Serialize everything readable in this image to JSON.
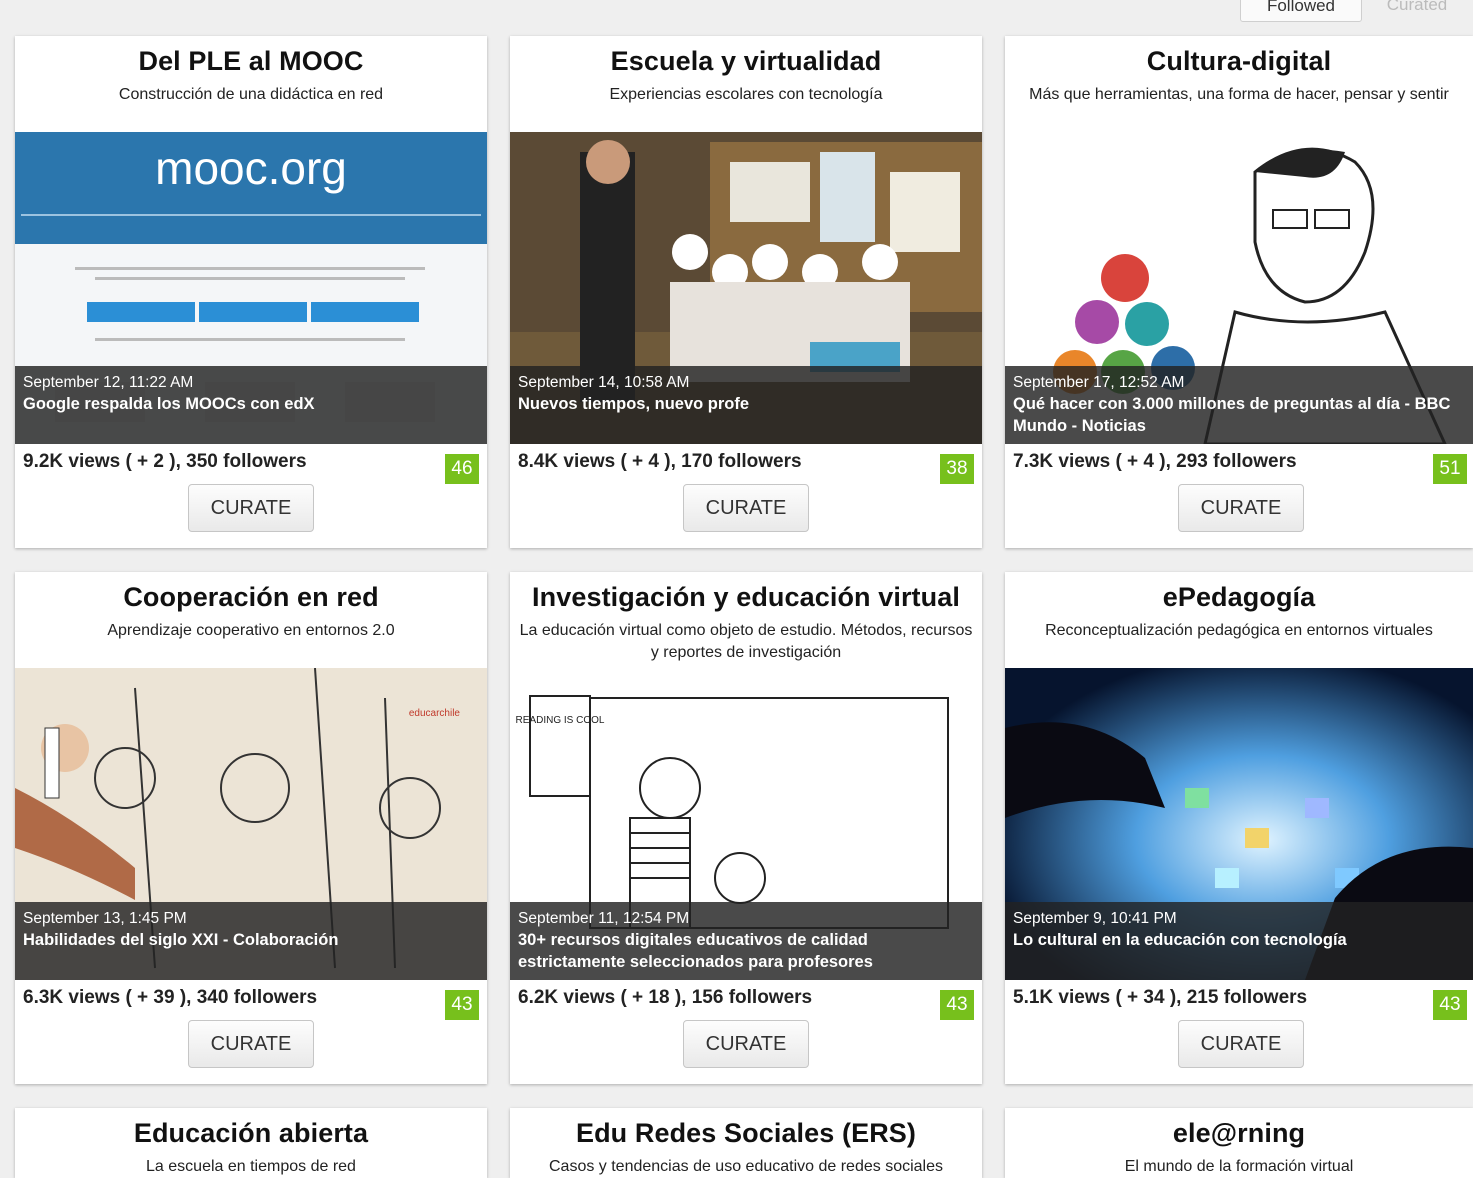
{
  "tabs": {
    "followed": "Followed",
    "curated": "Curated"
  },
  "cards": [
    {
      "title": "Del PLE al MOOC",
      "subtitle": "Construcción de una didáctica en red",
      "date": "September 12, 11:22 AM",
      "post": "Google respalda los MOOCs con edX",
      "stats": "9.2K views ( + 2 ), 350 followers",
      "score": "46",
      "curate": "CURATE",
      "thumb_text": "mooc.org"
    },
    {
      "title": "Escuela y virtualidad",
      "subtitle": "Experiencias escolares con tecnología",
      "date": "September 14, 10:58 AM",
      "post": "Nuevos tiempos, nuevo profe",
      "stats": "8.4K views ( + 4 ), 170 followers",
      "score": "38",
      "curate": "CURATE"
    },
    {
      "title": "Cultura-digital",
      "subtitle": "Más que herramientas, una forma de hacer, pensar y sentir",
      "date": "September 17, 12:52 AM",
      "post": "Qué hacer con 3.000 millones de preguntas al día - BBC Mundo - Noticias",
      "stats": "7.3K views ( + 4 ), 293 followers",
      "score": "51",
      "curate": "CURATE"
    },
    {
      "title": "Cooperación en red",
      "subtitle": "Aprendizaje cooperativo en entornos 2.0",
      "date": "September 13, 1:45 PM",
      "post": "Habilidades del siglo XXI - Colaboración",
      "stats": "6.3K views ( + 39 ), 340 followers",
      "score": "43",
      "curate": "CURATE",
      "thumb_text": "educarchile"
    },
    {
      "title": "Investigación y educación virtual",
      "subtitle": "La educación virtual como objeto de estudio. Métodos, recursos y reportes de investigación",
      "date": "September 11, 12:54 PM",
      "post": "30+ recursos digitales educativos de calidad estrictamente seleccionados para profesores",
      "stats": "6.2K views ( + 18 ), 156 followers",
      "score": "43",
      "curate": "CURATE",
      "thumb_text": "READING IS COOL"
    },
    {
      "title": "ePedagogía",
      "subtitle": "Reconceptualización pedagógica en entornos virtuales",
      "date": "September 9, 10:41 PM",
      "post": "Lo cultural en la educación con tecnología",
      "stats": "5.1K views ( + 34 ), 215 followers",
      "score": "43",
      "curate": "CURATE"
    },
    {
      "title": "Educación abierta",
      "subtitle": "La escuela en tiempos de red"
    },
    {
      "title": "Edu Redes Sociales (ERS)",
      "subtitle": "Casos y tendencias de uso educativo de redes sociales"
    },
    {
      "title": "ele@rning",
      "subtitle": "El mundo de la formación virtual"
    }
  ]
}
